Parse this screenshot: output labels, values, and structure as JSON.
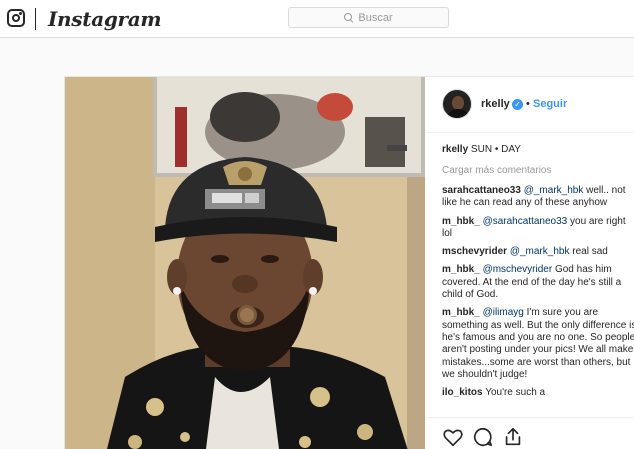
{
  "nav": {
    "wordmark": "Instagram",
    "search_placeholder": "Buscar"
  },
  "post": {
    "username": "rkelly",
    "follow_label": "Seguir",
    "separator": "•",
    "caption_user": "rkelly",
    "caption_text": "SUN • DAY",
    "load_more": "Cargar más comentarios"
  },
  "comments": [
    {
      "user": "sarahcattaneo33",
      "mention": "@_mark_hbk",
      "text": "well.. not like he can read any of these anyhow"
    },
    {
      "user": "m_hbk_",
      "mention": "@sarahcattaneo33",
      "text": "you are right lol"
    },
    {
      "user": "mschevyrider",
      "mention": "@_mark_hbk",
      "text": "real sad"
    },
    {
      "user": "m_hbk_",
      "mention": "@mschevyrider",
      "text": "God has him covered. At the end of the day he's still a child of God."
    },
    {
      "user": "m_hbk_",
      "mention": "@ilimayg",
      "text": "I'm sure you are something as well. But the only difference is he's famous and you are no one. So people aren't posting under your pics! We all make mistakes...some are worst than others, but we shouldn't judge!"
    },
    {
      "user": "ilo_kitos",
      "mention": "",
      "text": "You're such a"
    }
  ],
  "colors": {
    "link_blue": "#3897f0",
    "mention_blue": "#003569",
    "muted": "#999999",
    "border": "#dbdbdb"
  },
  "icons": [
    "instagram-glyph-icon",
    "search-icon",
    "verified-badge-icon",
    "heart-icon",
    "comment-icon",
    "share-icon"
  ]
}
